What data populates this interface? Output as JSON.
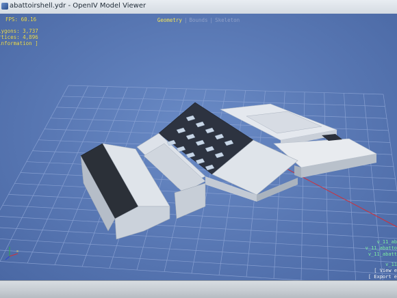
{
  "window": {
    "title": "abattoirshell.ydr - OpenIV Model Viewer"
  },
  "hud": {
    "fps": "FPS: 60.16",
    "polygons": "Polygons: 3,737",
    "vertices": "Vertices: 4,896",
    "information": "[ information ]"
  },
  "mode_tabs": [
    {
      "label": "Geometry",
      "active": true
    },
    {
      "label": "Bounds",
      "active": false
    },
    {
      "label": "Skeleton",
      "active": false
    }
  ],
  "mesh_list": [
    "v_11_ab",
    "v_11_abatto",
    "v_11_abatt",
    "v_11"
  ],
  "actions": [
    "[ View e",
    "[ Export e"
  ],
  "colors": {
    "viewport_bg": "#5877b3",
    "hud_text": "#f1e25a",
    "mesh_text": "#7ef0a0",
    "grid_line": "#8fa6d6",
    "axis_red": "#d0303a",
    "axis_green": "#2ea84a",
    "axis_blue": "#2a3fd0"
  }
}
